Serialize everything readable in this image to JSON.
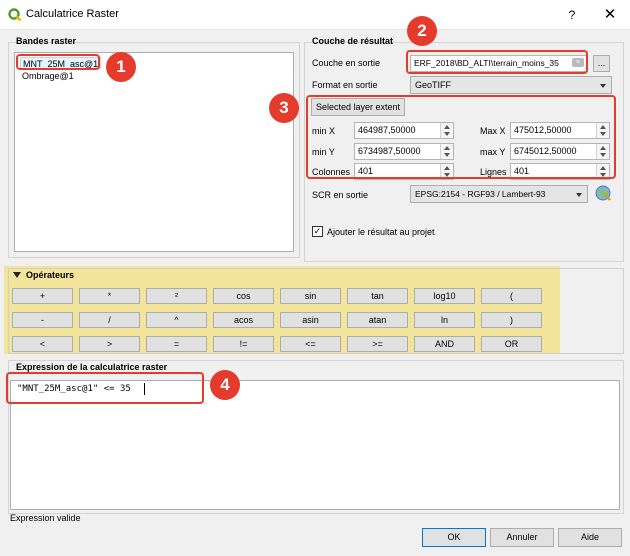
{
  "window": {
    "title": "Calculatrice Raster",
    "help": "?",
    "close": "✕"
  },
  "bands": {
    "title": "Bandes raster",
    "items": [
      "MNT_25M_asc@1",
      "Ombrage@1"
    ]
  },
  "result": {
    "title": "Couche de résultat",
    "output_label": "Couche en sortie",
    "output_value": "ERF_2018\\BD_ALTI\\terrain_moins_35",
    "browse": "...",
    "format_label": "Format en sortie",
    "format_value": "GeoTIFF",
    "extent_button": "Selected layer extent",
    "minx_label": "min X",
    "minx": "464987,50000",
    "maxx_label": "Max X",
    "maxx": "475012,50000",
    "miny_label": "min Y",
    "miny": "6734987,50000",
    "maxy_label": "max Y",
    "maxy": "6745012,50000",
    "cols_label": "Colonnes",
    "cols": "401",
    "rows_label": "Lignes",
    "rows": "401",
    "crs_label": "SCR en sortie",
    "crs_value": "EPSG:2154 - RGF93 / Lambert-93",
    "add_label": "Ajouter le résultat au projet"
  },
  "operators": {
    "title": "Opérateurs",
    "row1": [
      "+",
      "*",
      "²",
      "cos",
      "sin",
      "tan",
      "log10",
      "("
    ],
    "row2": [
      "-",
      "/",
      "^",
      "acos",
      "asin",
      "atan",
      "ln",
      ")"
    ],
    "row3": [
      "<",
      ">",
      "=",
      "!=",
      "<=",
      ">=",
      "AND",
      "OR"
    ]
  },
  "expression": {
    "title": "Expression de la calculatrice raster",
    "value": "\"MNT_25M_asc@1\" <= 35"
  },
  "status": "Expression valide",
  "buttons": {
    "ok": "OK",
    "cancel": "Annuler",
    "help": "Aide"
  },
  "markers": [
    "1",
    "2",
    "3",
    "4"
  ],
  "colors": {
    "marker": "#e53b2c",
    "operators_highlight": "#f3e49b",
    "qgis_green": "#589632"
  }
}
